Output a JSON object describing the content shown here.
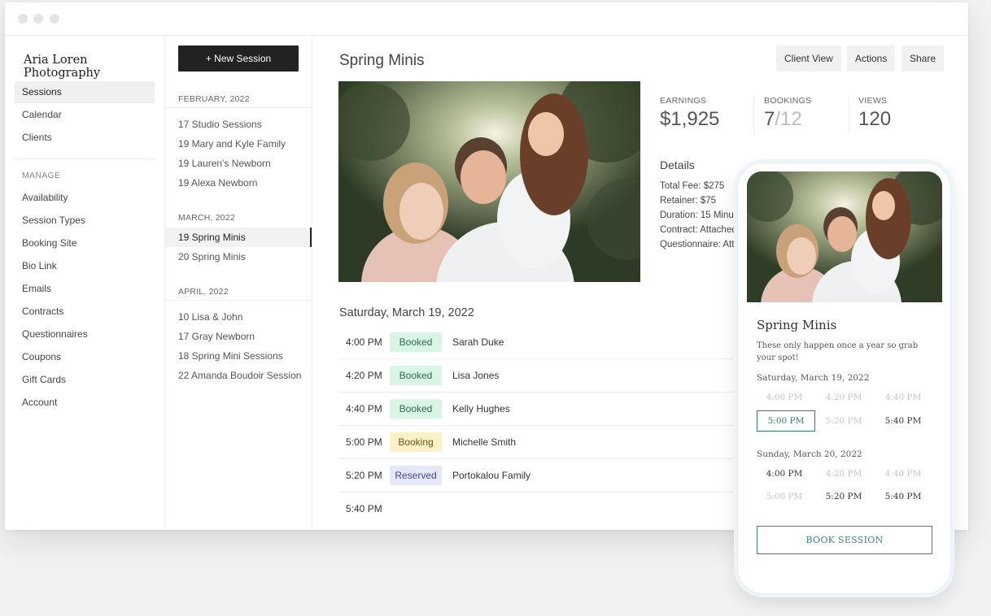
{
  "brand": "Aria Loren Photography",
  "nav": {
    "primary": [
      {
        "label": "Sessions",
        "active": true
      },
      {
        "label": "Calendar"
      },
      {
        "label": "Clients"
      }
    ],
    "section_label": "MANAGE",
    "manage": [
      "Availability",
      "Session Types",
      "Booking Site",
      "Bio Link",
      "Emails",
      "Contracts",
      "Questionnaires",
      "Coupons",
      "Gift Cards",
      "Account"
    ]
  },
  "sessions": {
    "new_button": "+ New Session",
    "groups": [
      {
        "month": "FEBRUARY, 2022",
        "items": [
          "17 Studio Sessions",
          "19 Mary and Kyle Family",
          "19 Lauren's Newborn",
          "19 Alexa Newborn"
        ]
      },
      {
        "month": "MARCH, 2022",
        "items": [
          "19 Spring Minis",
          "20 Spring Minis"
        ]
      },
      {
        "month": "APRIL, 2022",
        "items": [
          "10 Lisa & John",
          "17 Gray Newborn",
          "18 Spring Mini Sessions",
          "22 Amanda Boudoir Session"
        ]
      }
    ]
  },
  "main": {
    "title": "Spring Minis",
    "buttons": {
      "client_view": "Client View",
      "actions": "Actions",
      "share": "Share"
    },
    "stats": {
      "earnings_label": "EARNINGS",
      "earnings": "$1,925",
      "bookings_label": "BOOKINGS",
      "bookings_done": "7",
      "bookings_total": "/12",
      "views_label": "VIEWS",
      "views": "120"
    },
    "details_heading": "Details",
    "details": [
      "Total Fee: $275",
      "Retainer: $75",
      "Duration: 15 Minu",
      "Contract: Attached",
      "Questionnaire: Att"
    ],
    "date_heading": "Saturday, March 19, 2022",
    "slots": [
      {
        "time": "4:00 PM",
        "status": "Booked",
        "client": "Sarah Duke"
      },
      {
        "time": "4:20 PM",
        "status": "Booked",
        "client": "Lisa Jones"
      },
      {
        "time": "4:40 PM",
        "status": "Booked",
        "client": "Kelly Hughes"
      },
      {
        "time": "5:00 PM",
        "status": "Booking",
        "client": "Michelle Smith"
      },
      {
        "time": "5:20 PM",
        "status": "Reserved",
        "client": "Portokalou Family"
      },
      {
        "time": "5:40 PM",
        "status": "",
        "client": ""
      }
    ]
  },
  "phone": {
    "title": "Spring Minis",
    "description": "These only happen once a year so grab your spot!",
    "days": [
      {
        "label": "Saturday, March 19, 2022",
        "slots": [
          {
            "time": "4:00 PM",
            "state": "unavailable"
          },
          {
            "time": "4:20 PM",
            "state": "unavailable"
          },
          {
            "time": "4:40 PM",
            "state": "unavailable"
          },
          {
            "time": "5:00 PM",
            "state": "selected"
          },
          {
            "time": "5:20 PM",
            "state": "unavailable"
          },
          {
            "time": "5:40 PM",
            "state": "available"
          }
        ]
      },
      {
        "label": "Sunday, March 20, 2022",
        "slots": [
          {
            "time": "4:00 PM",
            "state": "available"
          },
          {
            "time": "4:20 PM",
            "state": "unavailable"
          },
          {
            "time": "4:40 PM",
            "state": "unavailable"
          },
          {
            "time": "5:00 PM",
            "state": "unavailable"
          },
          {
            "time": "5:20 PM",
            "state": "available"
          },
          {
            "time": "5:40 PM",
            "state": "available"
          }
        ]
      }
    ],
    "book_button": "BOOK SESSION"
  },
  "colors": {
    "booked_bg": "#d9f5e6",
    "booked_fg": "#2d6a4b",
    "booking_bg": "#fdf1c7",
    "booking_fg": "#6b5516",
    "reserved_bg": "#e5e7fb",
    "reserved_fg": "#3f4590",
    "accent": "#2f7a6c"
  }
}
